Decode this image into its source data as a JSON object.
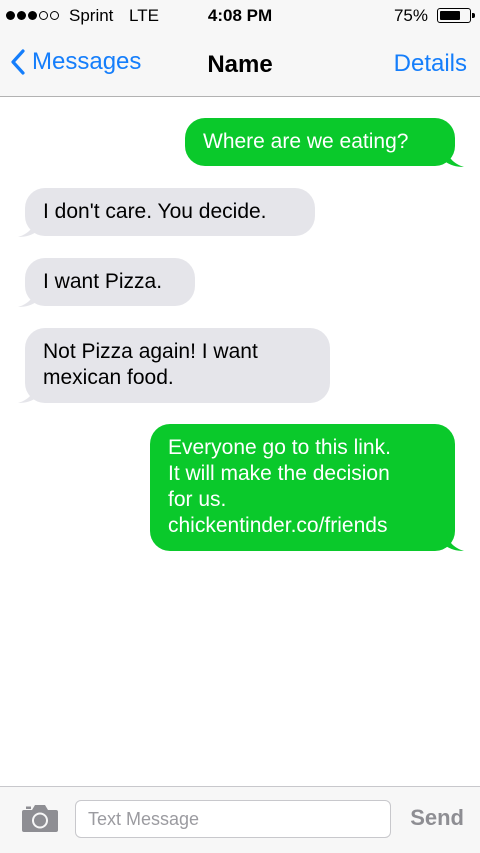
{
  "status_bar": {
    "signal_filled": 3,
    "signal_total": 5,
    "carrier": "Sprint",
    "network": "LTE",
    "time": "4:08 PM",
    "battery_percent": "75%",
    "battery_level": 0.75
  },
  "nav": {
    "back_label": "Messages",
    "title": "Name",
    "details_label": "Details"
  },
  "messages": [
    {
      "direction": "outgoing",
      "lines": [
        "Where are we eating?"
      ]
    },
    {
      "direction": "incoming",
      "lines": [
        "I don't care. You decide."
      ]
    },
    {
      "direction": "incoming",
      "lines": [
        "I want Pizza."
      ]
    },
    {
      "direction": "incoming",
      "lines": [
        "Not Pizza again! I want",
        "mexican food."
      ]
    },
    {
      "direction": "outgoing",
      "lines": [
        "Everyone go to this link.",
        "It will make the decision",
        "for us.",
        "chickentinder.co/friends"
      ]
    }
  ],
  "composer": {
    "placeholder": "Text Message",
    "send_label": "Send"
  },
  "colors": {
    "accent": "#157efb",
    "outgoing_bubble": "#0ac92b",
    "incoming_bubble": "#e5e5ea"
  },
  "icons": {
    "back": "chevron-left-icon",
    "camera": "camera-icon"
  }
}
